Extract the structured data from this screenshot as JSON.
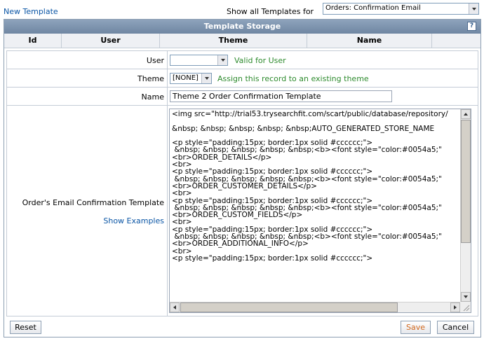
{
  "top": {
    "new_template": "New Template",
    "show_all_label": "Show all Templates for",
    "filter_value": "Orders: Confirmation Email"
  },
  "panel": {
    "title": "Template Storage",
    "help_icon": "?",
    "columns": [
      "Id",
      "User",
      "Theme",
      "Name"
    ]
  },
  "form": {
    "user_label": "User",
    "user_value": "",
    "user_hint": "Valid for User",
    "theme_label": "Theme",
    "theme_value": "[NONE]",
    "theme_hint": "Assign this record to an existing theme",
    "name_label": "Name",
    "name_value": "Theme 2 Order Confirmation Template",
    "template_label": "Order's Email Confirmation Template",
    "show_examples": "Show Examples",
    "template_content": "<img src=\"http://trial53.trysearchfit.com/scart/public/database/repository/\n\n&nbsp; &nbsp; &nbsp; &nbsp; &nbsp;AUTO_GENERATED_STORE_NAME\n\n<p style=\"padding:15px; border:1px solid #cccccc;\">\n &nbsp; &nbsp; &nbsp; &nbsp; &nbsp;<b><font style=\"color:#0054a5;\"\n<br>ORDER_DETAILS</p>\n<br>\n<p style=\"padding:15px; border:1px solid #cccccc;\">\n &nbsp; &nbsp; &nbsp; &nbsp; &nbsp;<b><font style=\"color:#0054a5;\"\n<br>ORDER_CUSTOMER_DETAILS</p>\n<br>\n<p style=\"padding:15px; border:1px solid #cccccc;\">\n &nbsp; &nbsp; &nbsp; &nbsp; &nbsp;<b><font style=\"color:#0054a5;\"\n<br>ORDER_CUSTOM_FIELDS</p>\n<br>\n<p style=\"padding:15px; border:1px solid #cccccc;\">\n &nbsp; &nbsp; &nbsp; &nbsp; &nbsp;<b><font style=\"color:#0054a5;\"\n<br>ORDER_ADDITIONAL_INFO</p>\n<br>\n<p style=\"padding:15px; border:1px solid #cccccc;\">"
  },
  "buttons": {
    "reset": "Reset",
    "save": "Save",
    "cancel": "Cancel"
  },
  "colors": {
    "link": "#0a55a5",
    "hint": "#2e8b2e",
    "title_bar": "#7b90aa",
    "save_text": "#d2691e"
  }
}
